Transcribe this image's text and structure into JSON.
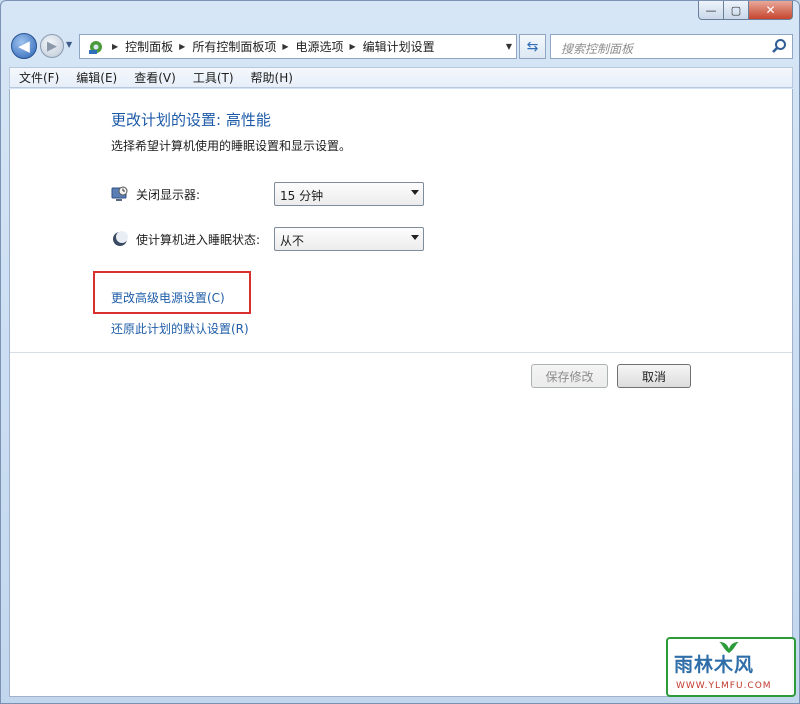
{
  "window": {
    "close_glyph": "✕",
    "max_glyph": "▢",
    "min_glyph": "—"
  },
  "nav": {
    "back_glyph": "◀",
    "forward_glyph": "▶",
    "breadcrumbs": [
      "控制面板",
      "所有控制面板项",
      "电源选项",
      "编辑计划设置"
    ],
    "search_placeholder": "搜索控制面板"
  },
  "menu": [
    "文件(F)",
    "编辑(E)",
    "查看(V)",
    "工具(T)",
    "帮助(H)"
  ],
  "page": {
    "title": "更改计划的设置: 高性能",
    "subtitle": "选择希望计算机使用的睡眠设置和显示设置。",
    "display_off": {
      "label": "关闭显示器:",
      "value": "15 分钟"
    },
    "sleep": {
      "label": "使计算机进入睡眠状态:",
      "value": "从不"
    },
    "advanced_link": "更改高级电源设置(C)",
    "restore_link": "还原此计划的默认设置(R)",
    "save_button": "保存修改",
    "cancel_button": "取消"
  },
  "watermark": {
    "brand": "雨林木风",
    "url": "WWW.YLMFU.COM"
  },
  "colors": {
    "highlight_box": "#d9312e",
    "link": "#1f5ea8",
    "title": "#1d5aa8"
  }
}
